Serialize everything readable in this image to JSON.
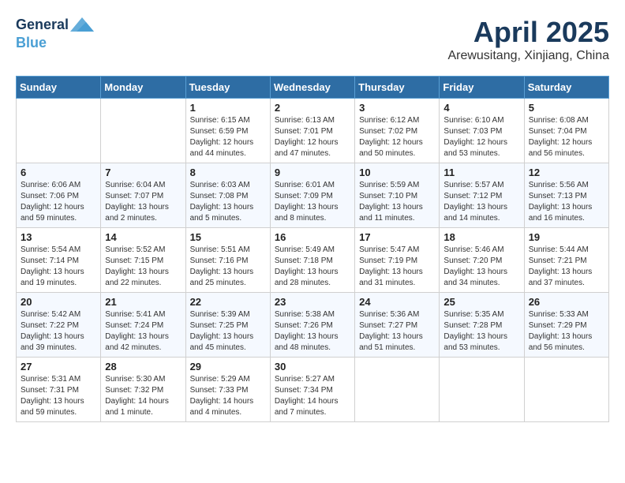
{
  "header": {
    "logo_line1": "General",
    "logo_line2": "Blue",
    "title": "April 2025",
    "location": "Arewusitang, Xinjiang, China"
  },
  "weekdays": [
    "Sunday",
    "Monday",
    "Tuesday",
    "Wednesday",
    "Thursday",
    "Friday",
    "Saturday"
  ],
  "weeks": [
    [
      {
        "day": "",
        "info": ""
      },
      {
        "day": "",
        "info": ""
      },
      {
        "day": "1",
        "info": "Sunrise: 6:15 AM\nSunset: 6:59 PM\nDaylight: 12 hours\nand 44 minutes."
      },
      {
        "day": "2",
        "info": "Sunrise: 6:13 AM\nSunset: 7:01 PM\nDaylight: 12 hours\nand 47 minutes."
      },
      {
        "day": "3",
        "info": "Sunrise: 6:12 AM\nSunset: 7:02 PM\nDaylight: 12 hours\nand 50 minutes."
      },
      {
        "day": "4",
        "info": "Sunrise: 6:10 AM\nSunset: 7:03 PM\nDaylight: 12 hours\nand 53 minutes."
      },
      {
        "day": "5",
        "info": "Sunrise: 6:08 AM\nSunset: 7:04 PM\nDaylight: 12 hours\nand 56 minutes."
      }
    ],
    [
      {
        "day": "6",
        "info": "Sunrise: 6:06 AM\nSunset: 7:06 PM\nDaylight: 12 hours\nand 59 minutes."
      },
      {
        "day": "7",
        "info": "Sunrise: 6:04 AM\nSunset: 7:07 PM\nDaylight: 13 hours\nand 2 minutes."
      },
      {
        "day": "8",
        "info": "Sunrise: 6:03 AM\nSunset: 7:08 PM\nDaylight: 13 hours\nand 5 minutes."
      },
      {
        "day": "9",
        "info": "Sunrise: 6:01 AM\nSunset: 7:09 PM\nDaylight: 13 hours\nand 8 minutes."
      },
      {
        "day": "10",
        "info": "Sunrise: 5:59 AM\nSunset: 7:10 PM\nDaylight: 13 hours\nand 11 minutes."
      },
      {
        "day": "11",
        "info": "Sunrise: 5:57 AM\nSunset: 7:12 PM\nDaylight: 13 hours\nand 14 minutes."
      },
      {
        "day": "12",
        "info": "Sunrise: 5:56 AM\nSunset: 7:13 PM\nDaylight: 13 hours\nand 16 minutes."
      }
    ],
    [
      {
        "day": "13",
        "info": "Sunrise: 5:54 AM\nSunset: 7:14 PM\nDaylight: 13 hours\nand 19 minutes."
      },
      {
        "day": "14",
        "info": "Sunrise: 5:52 AM\nSunset: 7:15 PM\nDaylight: 13 hours\nand 22 minutes."
      },
      {
        "day": "15",
        "info": "Sunrise: 5:51 AM\nSunset: 7:16 PM\nDaylight: 13 hours\nand 25 minutes."
      },
      {
        "day": "16",
        "info": "Sunrise: 5:49 AM\nSunset: 7:18 PM\nDaylight: 13 hours\nand 28 minutes."
      },
      {
        "day": "17",
        "info": "Sunrise: 5:47 AM\nSunset: 7:19 PM\nDaylight: 13 hours\nand 31 minutes."
      },
      {
        "day": "18",
        "info": "Sunrise: 5:46 AM\nSunset: 7:20 PM\nDaylight: 13 hours\nand 34 minutes."
      },
      {
        "day": "19",
        "info": "Sunrise: 5:44 AM\nSunset: 7:21 PM\nDaylight: 13 hours\nand 37 minutes."
      }
    ],
    [
      {
        "day": "20",
        "info": "Sunrise: 5:42 AM\nSunset: 7:22 PM\nDaylight: 13 hours\nand 39 minutes."
      },
      {
        "day": "21",
        "info": "Sunrise: 5:41 AM\nSunset: 7:24 PM\nDaylight: 13 hours\nand 42 minutes."
      },
      {
        "day": "22",
        "info": "Sunrise: 5:39 AM\nSunset: 7:25 PM\nDaylight: 13 hours\nand 45 minutes."
      },
      {
        "day": "23",
        "info": "Sunrise: 5:38 AM\nSunset: 7:26 PM\nDaylight: 13 hours\nand 48 minutes."
      },
      {
        "day": "24",
        "info": "Sunrise: 5:36 AM\nSunset: 7:27 PM\nDaylight: 13 hours\nand 51 minutes."
      },
      {
        "day": "25",
        "info": "Sunrise: 5:35 AM\nSunset: 7:28 PM\nDaylight: 13 hours\nand 53 minutes."
      },
      {
        "day": "26",
        "info": "Sunrise: 5:33 AM\nSunset: 7:29 PM\nDaylight: 13 hours\nand 56 minutes."
      }
    ],
    [
      {
        "day": "27",
        "info": "Sunrise: 5:31 AM\nSunset: 7:31 PM\nDaylight: 13 hours\nand 59 minutes."
      },
      {
        "day": "28",
        "info": "Sunrise: 5:30 AM\nSunset: 7:32 PM\nDaylight: 14 hours\nand 1 minute."
      },
      {
        "day": "29",
        "info": "Sunrise: 5:29 AM\nSunset: 7:33 PM\nDaylight: 14 hours\nand 4 minutes."
      },
      {
        "day": "30",
        "info": "Sunrise: 5:27 AM\nSunset: 7:34 PM\nDaylight: 14 hours\nand 7 minutes."
      },
      {
        "day": "",
        "info": ""
      },
      {
        "day": "",
        "info": ""
      },
      {
        "day": "",
        "info": ""
      }
    ]
  ]
}
